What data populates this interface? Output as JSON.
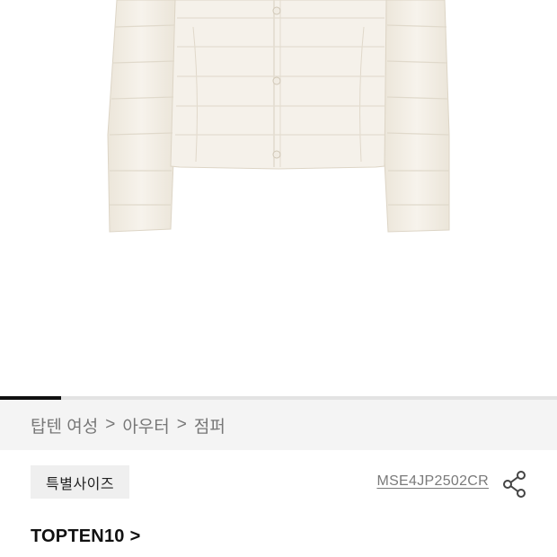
{
  "product": {
    "image_progress": 0.11,
    "breadcrumb": [
      "탑텐 여성",
      "아우터",
      "점퍼"
    ],
    "breadcrumb_separator": ">",
    "badge": "특별사이즈",
    "sku": "MSE4JP2502CR",
    "brand": "TOPTEN10",
    "brand_chevron": ">"
  },
  "icons": {
    "share": "share-icon",
    "brand_arrow": "chevron-right-icon"
  },
  "colors": {
    "jacket": "#f3efe6",
    "progress_fill": "#111111",
    "breadcrumb_bg": "#f4f4f4"
  }
}
